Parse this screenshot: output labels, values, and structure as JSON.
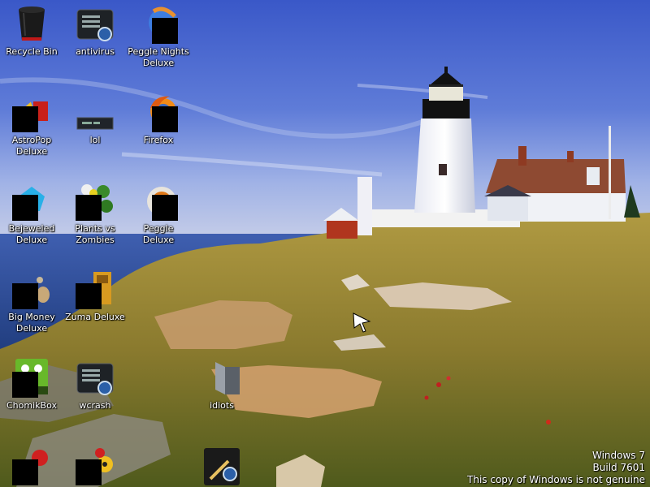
{
  "desktop": {
    "icons": [
      {
        "label": "Recycle Bin",
        "icon": "recycle-bin-icon"
      },
      {
        "label": "antivirus",
        "icon": "antivirus-icon"
      },
      {
        "label": "Peggle Nights\nDeluxe",
        "icon": "peggle-nights-icon"
      },
      {
        "label": "AstroPop\nDeluxe",
        "icon": "astropop-icon"
      },
      {
        "label": "lol",
        "icon": "lol-icon"
      },
      {
        "label": "Firefox",
        "icon": "firefox-icon"
      },
      {
        "label": "Bejeweled\nDeluxe",
        "icon": "bejeweled-icon"
      },
      {
        "label": "Plants vs\nZombies",
        "icon": "plants-vs-zombies-icon"
      },
      {
        "label": "Peggle Deluxe",
        "icon": "peggle-deluxe-icon"
      },
      {
        "label": "Big Money\nDeluxe",
        "icon": "big-money-icon"
      },
      {
        "label": "Zuma Deluxe",
        "icon": "zuma-deluxe-icon"
      },
      {
        "label": "ChomikBox",
        "icon": "chomikbox-icon"
      },
      {
        "label": "wcrash",
        "icon": "wcrash-icon"
      },
      {
        "label": "idiots",
        "icon": "folder-icon"
      },
      {
        "label": "",
        "icon": "game-icon"
      },
      {
        "label": "",
        "icon": "game-icon"
      },
      {
        "label": "",
        "icon": "tool-icon"
      }
    ]
  },
  "watermark": {
    "line1": "Windows 7",
    "line2": "Build 7601",
    "line3": "This copy of Windows is not genuine"
  }
}
